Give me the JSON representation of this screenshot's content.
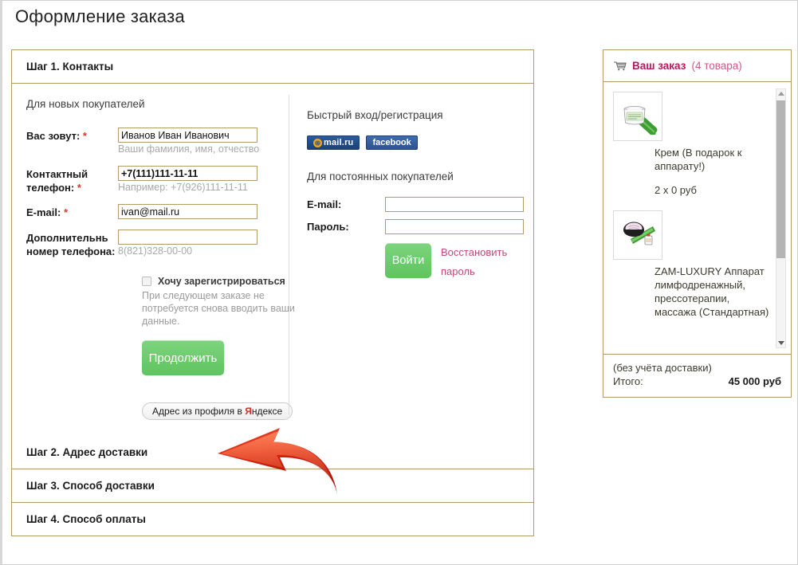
{
  "page": {
    "title": "Оформление заказа"
  },
  "steps": [
    {
      "label": "Шаг 1. Контакты"
    },
    {
      "label": "Шаг 2. Адрес доставки"
    },
    {
      "label": "Шаг 3. Способ доставки"
    },
    {
      "label": "Шаг 4. Способ оплаты"
    }
  ],
  "new_customers": {
    "section_title": "Для новых покупателей",
    "fields": [
      {
        "label": "Вас зовут:",
        "required": "*",
        "value": "Иванов Иван Иванович",
        "hint": "Ваши фамилия, имя, отчество"
      },
      {
        "label": "Контактный телефон:",
        "required": "*",
        "value": "+7(111)111-11-11",
        "hint": "Например: +7(926)111-11-11"
      },
      {
        "label": "E-mail:",
        "required": "*",
        "value": "ivan@mail.ru",
        "hint": ""
      },
      {
        "label": "Дополнительнь номер телефона:",
        "required": "",
        "value": "",
        "hint": "8(821)328-00-00"
      }
    ],
    "register_checkbox": {
      "label": "Хочу зарегистрироваться",
      "checked": false
    },
    "register_note": "При следующем заказе не потребуется снова вводить ваши данные.",
    "continue_button": "Продолжить",
    "yandex_button": {
      "prefix": "Адрес из профиля в ",
      "brand_letter": "Я",
      "suffix": "ндексе"
    }
  },
  "quick_login": {
    "section_title": "Быстрый вход/регистрация",
    "social": [
      {
        "name": "mail.ru",
        "label": "mail.ru"
      },
      {
        "name": "facebook",
        "label": "facebook"
      }
    ],
    "returning_title": "Для постоянных покупателей",
    "email_label": "E-mail:",
    "email_value": "",
    "password_label": "Пароль:",
    "password_value": "",
    "login_button": "Войти",
    "restore_link": "Восстановить пароль"
  },
  "order": {
    "title": "Ваш заказ",
    "count": "(4 товара)",
    "items": [
      {
        "name": "Крем (В подарок к аппарату!)",
        "qty": "2 x 0 руб",
        "icon": "cream-jar-aloe"
      },
      {
        "name": "ZAM-LUXURY Аппарат лимфодренажный, прессотерапии, массажа (Стандартная)",
        "qty": "",
        "icon": "massage-device"
      }
    ],
    "shipping_note": "(без учёта доставки)",
    "total_label": "Итого:",
    "total_value": "45 000 руб"
  },
  "colors": {
    "panel_border": "#b29a6c",
    "accent_pink": "#b8175c",
    "link_pink": "#c4467a",
    "button_green": "#6cc96c",
    "required_red": "#d23b2e",
    "arrow_red": "#d42a10"
  }
}
